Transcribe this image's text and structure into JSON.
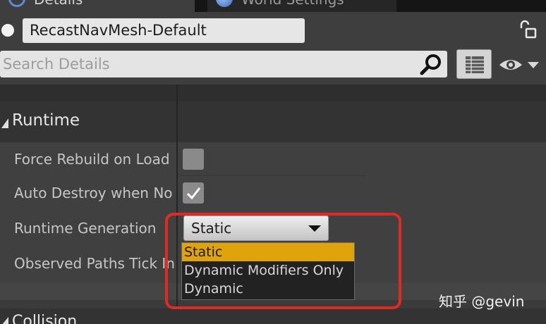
{
  "tabs": [
    {
      "label": "Details",
      "icon": "search-icon"
    },
    {
      "label": "World Settings",
      "icon": "globe-icon"
    }
  ],
  "actor": {
    "name": "RecastNavMesh-Default"
  },
  "search": {
    "placeholder": "Search Details"
  },
  "category": {
    "title": "Runtime"
  },
  "properties": [
    {
      "label": "Force Rebuild on Load",
      "checked": false
    },
    {
      "label": "Auto Destroy when No",
      "checked": true
    },
    {
      "label": "Runtime Generation"
    },
    {
      "label": "Observed Paths Tick In"
    }
  ],
  "runtime_generation": {
    "selected": "Static",
    "options": [
      "Static",
      "Dynamic Modifiers Only",
      "Dynamic"
    ]
  },
  "next_category": {
    "title": "Collision"
  },
  "watermark": "知乎 @gevin",
  "colors": {
    "accent_selected": "#e0a30b",
    "annotation_box": "#e02b24"
  }
}
